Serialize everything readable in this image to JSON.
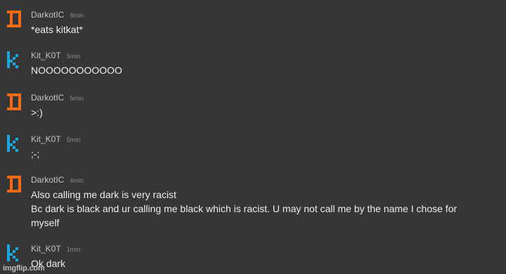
{
  "users": {
    "darkot": {
      "name": "DarkotIC",
      "icon": "orange-pixel-d-avatar-icon",
      "color": "#f36c15"
    },
    "kit": {
      "name": "Kit_K0T",
      "icon": "blue-pixel-k-avatar-icon",
      "color": "#1aa6dc"
    }
  },
  "messages": [
    {
      "author": "DarkotIC",
      "time": "8min",
      "lines": [
        "*eats kitkat*"
      ]
    },
    {
      "author": "Kit_K0T",
      "time": "5min",
      "lines": [
        "NOOOOOOOOOOO"
      ]
    },
    {
      "author": "DarkotIC",
      "time": "5min",
      "lines": [
        ">:)"
      ]
    },
    {
      "author": "Kit_K0T",
      "time": "5min",
      "lines": [
        ";-;"
      ]
    },
    {
      "author": "DarkotIC",
      "time": "4min",
      "lines": [
        "Also calling me dark is very racist",
        "Bc dark is black and ur calling me black which is racist. U may not call me by the name I chose for",
        "myself"
      ]
    },
    {
      "author": "Kit_K0T",
      "time": "1min",
      "lines": [
        "Ok dark"
      ]
    }
  ],
  "watermark": "imgflip.com"
}
